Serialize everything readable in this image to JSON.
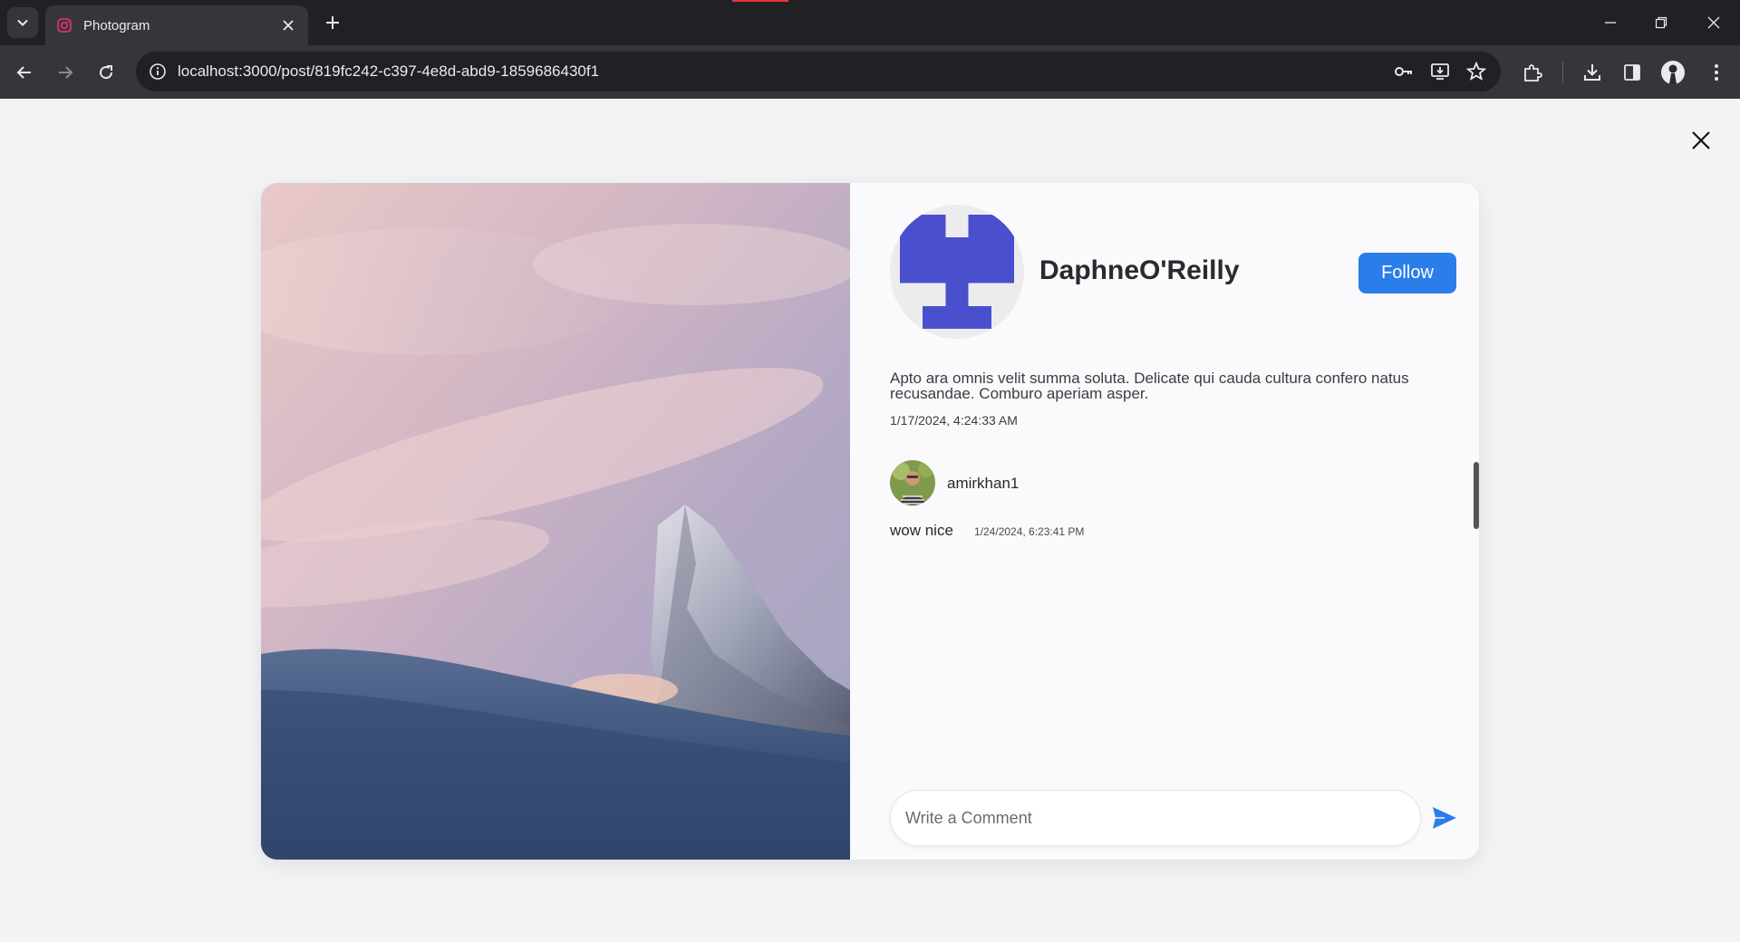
{
  "browser": {
    "tab": {
      "title": "Photogram"
    },
    "address_bar": {
      "url": "localhost:3000/post/819fc242-c397-4e8d-abd9-1859686430f1"
    }
  },
  "colors": {
    "accent": "#2b7de9",
    "avatar_pattern": "#4a4fce",
    "browser_dark": "#202124",
    "browser_toolbar": "#35363a"
  },
  "post": {
    "author": {
      "name": "DaphneO'Reilly",
      "avatar_icon": "identicon-avatar"
    },
    "follow_label": "Follow",
    "caption": "Apto ara omnis velit summa soluta. Delicate qui cauda cultura confero natus recusandae. Comburo aperiam asper.",
    "date": "1/17/2024, 4:24:33 AM",
    "image_alt": "snowy mountain peak at sunset"
  },
  "comments": [
    {
      "username": "amirkhan1",
      "text": "wow nice",
      "date": "1/24/2024, 6:23:41 PM"
    }
  ],
  "comment_input": {
    "placeholder": "Write a Comment",
    "value": ""
  }
}
